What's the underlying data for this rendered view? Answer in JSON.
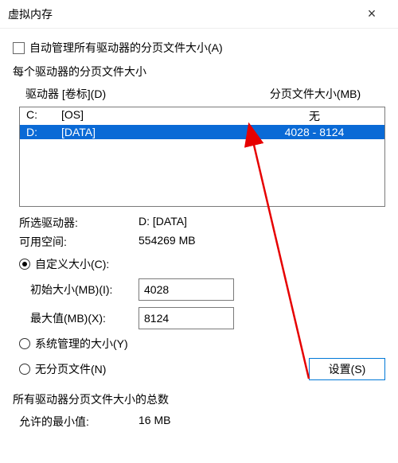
{
  "window": {
    "title": "虚拟内存",
    "close_label": "×"
  },
  "auto_manage": {
    "label": "自动管理所有驱动器的分页文件大小(A)"
  },
  "section_per_drive": "每个驱动器的分页文件大小",
  "list": {
    "header_drive": "驱动器 [卷标](D)",
    "header_size": "分页文件大小(MB)",
    "rows": [
      {
        "drive": "C:",
        "label": "[OS]",
        "size": "无"
      },
      {
        "drive": "D:",
        "label": "[DATA]",
        "size": "4028 - 8124"
      }
    ]
  },
  "selected": {
    "drive_label": "所选驱动器:",
    "drive_value": "D:  [DATA]",
    "space_label": "可用空间:",
    "space_value": "554269 MB"
  },
  "radios": {
    "custom": "自定义大小(C):",
    "system": "系统管理的大小(Y)",
    "none": "无分页文件(N)"
  },
  "inputs": {
    "initial_label": "初始大小(MB)(I):",
    "initial_value": "4028",
    "max_label": "最大值(MB)(X):",
    "max_value": "8124"
  },
  "set_button": "设置(S)",
  "totals": {
    "heading": "所有驱动器分页文件大小的总数",
    "min_label": "允许的最小值:",
    "min_value": "16 MB"
  }
}
